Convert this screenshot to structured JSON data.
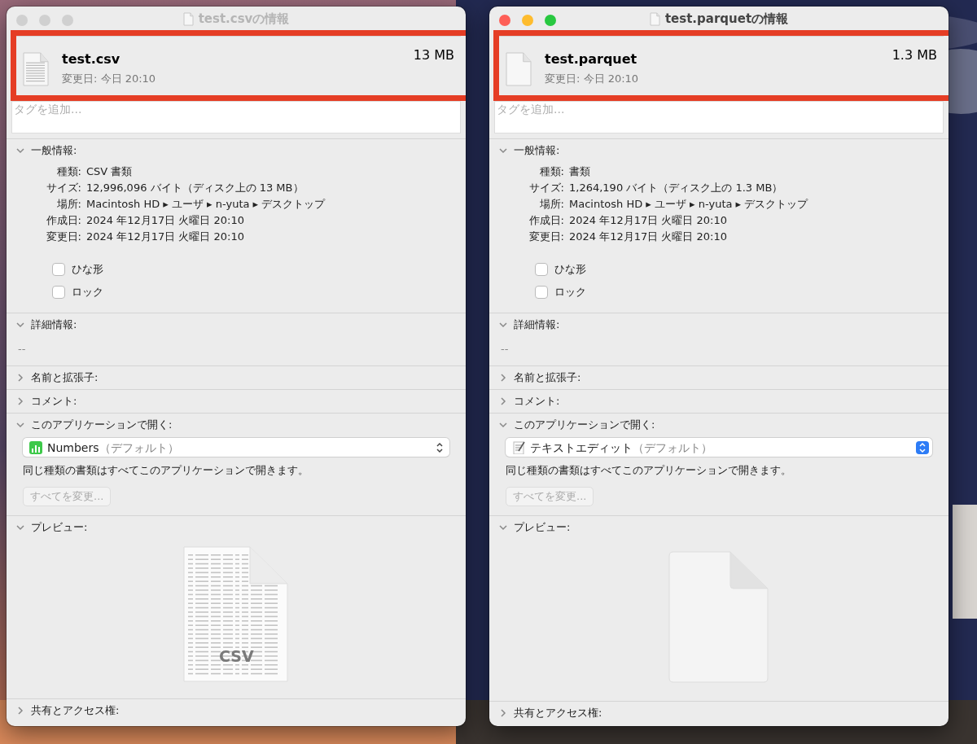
{
  "windows": [
    {
      "title": "test.csvの情報",
      "active": false,
      "file": {
        "name": "test.csv",
        "size": "13 MB",
        "modified": "変更日: 今日 20:10",
        "highlighted": true
      },
      "tags": {
        "placeholder": "タグを追加..."
      },
      "sections": [
        {
          "kind": "general",
          "title": "一般情報:",
          "expanded": true,
          "fields": [
            {
              "label": "種類:",
              "value": "CSV 書類"
            },
            {
              "label": "サイズ:",
              "value": "12,996,096 バイト（ディスク上の 13 MB）"
            },
            {
              "label": "場所:",
              "value": "Macintosh HD ▸ ユーザ ▸ n-yuta ▸ デスクトップ"
            },
            {
              "label": "作成日:",
              "value": "2024 年12月17日 火曜日 20:10"
            },
            {
              "label": "変更日:",
              "value": "2024 年12月17日 火曜日 20:10"
            }
          ],
          "checkboxes": [
            {
              "label": "ひな形",
              "checked": false
            },
            {
              "label": "ロック",
              "checked": false
            }
          ]
        },
        {
          "kind": "text",
          "title": "詳細情報:",
          "expanded": true,
          "text": "--"
        },
        {
          "kind": "collapsed",
          "title": "名前と拡張子:",
          "expanded": false
        },
        {
          "kind": "collapsed",
          "title": "コメント:",
          "expanded": false
        },
        {
          "kind": "open_with",
          "title": "このアプリケーションで開く:",
          "expanded": true,
          "app": {
            "kind": "spreadsheet",
            "name": "Numbers",
            "note": "（デフォルト）"
          },
          "description": "同じ種類の書類はすべてこのアプリケーションで開きます。",
          "button": {
            "label": "すべてを変更...",
            "disabled": true
          }
        },
        {
          "kind": "preview",
          "title": "プレビュー:",
          "expanded": true,
          "preview": {
            "kind": "table_document",
            "label": "CSV"
          }
        },
        {
          "kind": "collapsed",
          "title": "共有とアクセス権:",
          "expanded": false
        }
      ]
    },
    {
      "title": "test.parquetの情報",
      "active": true,
      "file": {
        "name": "test.parquet",
        "size": "1.3 MB",
        "modified": "変更日: 今日 20:10",
        "highlighted": true
      },
      "tags": {
        "placeholder": "タグを追加..."
      },
      "sections": [
        {
          "kind": "general",
          "title": "一般情報:",
          "expanded": true,
          "fields": [
            {
              "label": "種類:",
              "value": "書類"
            },
            {
              "label": "サイズ:",
              "value": "1,264,190 バイト（ディスク上の 1.3 MB）"
            },
            {
              "label": "場所:",
              "value": "Macintosh HD ▸ ユーザ ▸ n-yuta ▸ デスクトップ"
            },
            {
              "label": "作成日:",
              "value": "2024 年12月17日 火曜日 20:10"
            },
            {
              "label": "変更日:",
              "value": "2024 年12月17日 火曜日 20:10"
            }
          ],
          "checkboxes": [
            {
              "label": "ひな形",
              "checked": false
            },
            {
              "label": "ロック",
              "checked": false
            }
          ]
        },
        {
          "kind": "text",
          "title": "詳細情報:",
          "expanded": true,
          "text": "--"
        },
        {
          "kind": "collapsed",
          "title": "名前と拡張子:",
          "expanded": false
        },
        {
          "kind": "collapsed",
          "title": "コメント:",
          "expanded": false
        },
        {
          "kind": "open_with",
          "title": "このアプリケーションで開く:",
          "expanded": true,
          "app": {
            "kind": "text_editor",
            "name": "テキストエディット",
            "note": "（デフォルト）"
          },
          "description": "同じ種類の書類はすべてこのアプリケーションで開きます。",
          "button": {
            "label": "すべてを変更...",
            "disabled": true
          }
        },
        {
          "kind": "preview",
          "title": "プレビュー:",
          "expanded": true,
          "preview": {
            "kind": "blank_document"
          }
        },
        {
          "kind": "collapsed",
          "title": "共有とアクセス権:",
          "expanded": false
        }
      ]
    }
  ]
}
